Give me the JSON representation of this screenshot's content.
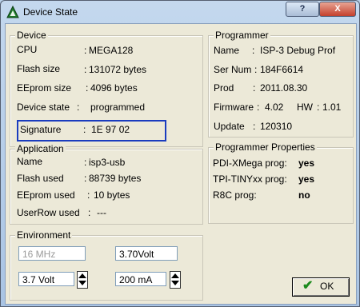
{
  "window": {
    "title": "Device State",
    "help_label": "?",
    "close_label": "X"
  },
  "device": {
    "legend": "Device",
    "rows": [
      {
        "label": "CPU",
        "sep": ":",
        "value": "MEGA128"
      },
      {
        "label": "Flash size",
        "sep": ":",
        "value": "131072 bytes"
      },
      {
        "label": "EEprom size",
        "sep": ":",
        "value": "4096 bytes"
      },
      {
        "label": "Device state",
        "sep": ":",
        "value": "programmed"
      },
      {
        "label": "Signature",
        "sep": ":",
        "value": "1E 97 02"
      }
    ]
  },
  "application": {
    "legend": "Application",
    "rows": [
      {
        "label": "Name",
        "sep": ":",
        "value": "isp3-usb"
      },
      {
        "label": "Flash used",
        "sep": ":",
        "value": "88739 bytes"
      },
      {
        "label": "EEprom used",
        "sep": ":",
        "value": "10 bytes"
      },
      {
        "label": "UserRow used",
        "sep": ":",
        "value": "---"
      }
    ]
  },
  "environment": {
    "legend": "Environment",
    "freq_value": "16 MHz",
    "volt_value": "3.70Volt",
    "volt_spin_value": "3.7  Volt",
    "current_spin_value": "200 mA"
  },
  "programmer": {
    "legend": "Programmer",
    "rows": [
      {
        "label": "Name",
        "sep": ":",
        "value": "ISP-3 Debug Prof"
      },
      {
        "label": "Ser Num",
        "sep": ":",
        "value": "184F6614"
      },
      {
        "label": "Prod",
        "sep": ":",
        "value": "2011.08.30"
      },
      {
        "label": "Firmware",
        "sep": ":",
        "value": "4.02"
      },
      {
        "label": "Update",
        "sep": ":",
        "value": "120310"
      }
    ],
    "hw_label": "HW",
    "hw_sep": ":",
    "hw_value": "1.01"
  },
  "properties": {
    "legend": "Programmer Properties",
    "rows": [
      {
        "label": "PDI-XMega prog:",
        "value": "yes"
      },
      {
        "label": "TPI-TINYxx prog:",
        "value": "yes"
      },
      {
        "label": "R8C prog:",
        "value": "no"
      }
    ]
  },
  "ok_label": "OK",
  "colors": {
    "signature_highlight": "#1a3cbf",
    "ok_check": "#1c8a1c"
  }
}
